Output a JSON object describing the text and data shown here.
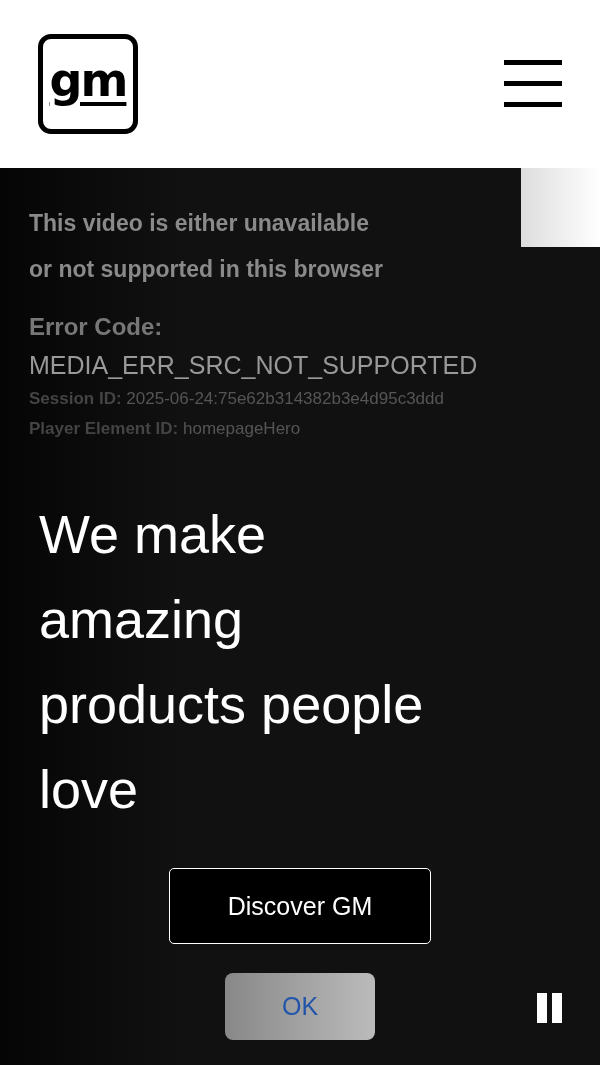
{
  "header": {
    "logo": "gm"
  },
  "error": {
    "message_lines": [
      "This video is either unavailable",
      "or not supported in this browser"
    ],
    "code_label": "Error Code:",
    "code": "MEDIA_ERR_SRC_NOT_SUPPORTED",
    "details": [
      {
        "label": "Session ID:",
        "value": "2025-06-24:75e62b314382b3e4d95c3ddd"
      },
      {
        "label": "Player Element ID:",
        "value": "homepageHero"
      }
    ]
  },
  "hero": {
    "headline_lines": [
      "We make",
      "amazing",
      "products people",
      "love"
    ],
    "cta": "Discover GM"
  },
  "dialog_button": "OK"
}
